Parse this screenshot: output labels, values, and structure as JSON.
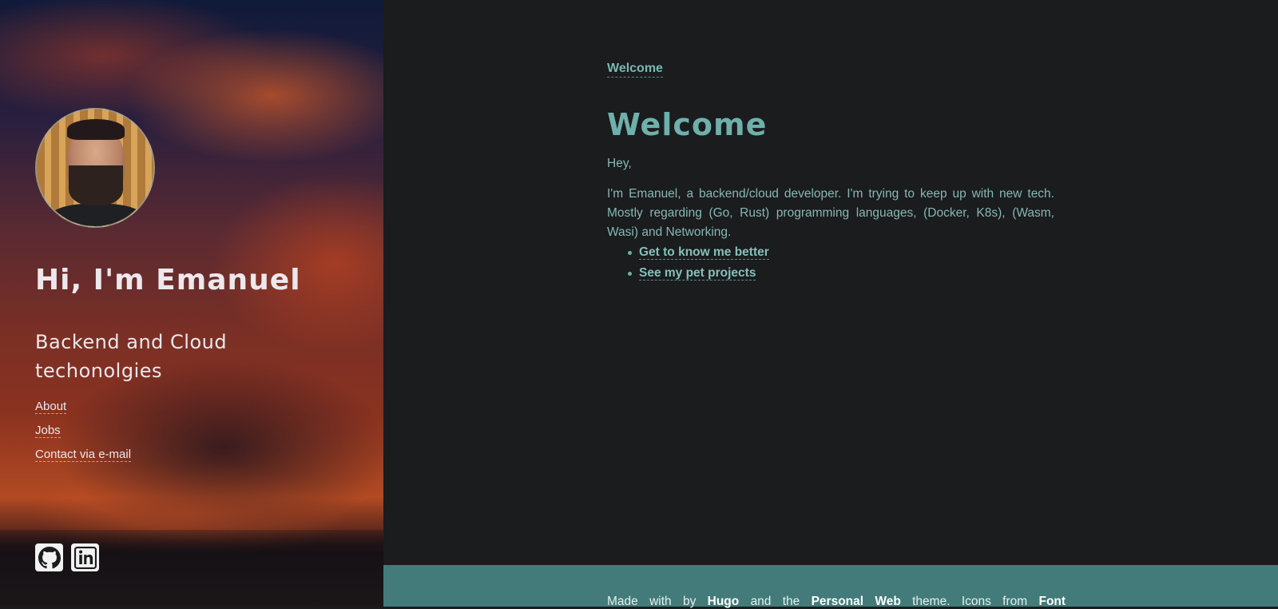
{
  "sidebar": {
    "title": "Hi, I'm Emanuel",
    "subtitle": "Backend and Cloud techonolgies",
    "nav": [
      {
        "label": "About"
      },
      {
        "label": "Jobs"
      },
      {
        "label": "Contact via e-mail"
      }
    ],
    "social": [
      {
        "icon": "github-icon"
      },
      {
        "icon": "linkedin-icon"
      }
    ]
  },
  "main": {
    "breadcrumb": "Welcome",
    "title": "Welcome",
    "greeting": "Hey,",
    "intro": "I'm Emanuel, a backend/cloud developer. I'm trying to keep up with new tech. Mostly regarding (Go, Rust) programming languages, (Docker, K8s), (Wasm, Wasi) and Networking.",
    "links": [
      {
        "label": "Get to know me better"
      },
      {
        "label": "See my pet projects"
      }
    ]
  },
  "footer": {
    "prefix": "Made with by",
    "hugo": "Hugo",
    "and_the": "and the",
    "theme": "Personal Web",
    "suffix": "theme. Icons from",
    "font": "Font"
  },
  "colors": {
    "accent": "#6fb0ab",
    "background": "#1a1c1e",
    "footer": "#427b79"
  }
}
